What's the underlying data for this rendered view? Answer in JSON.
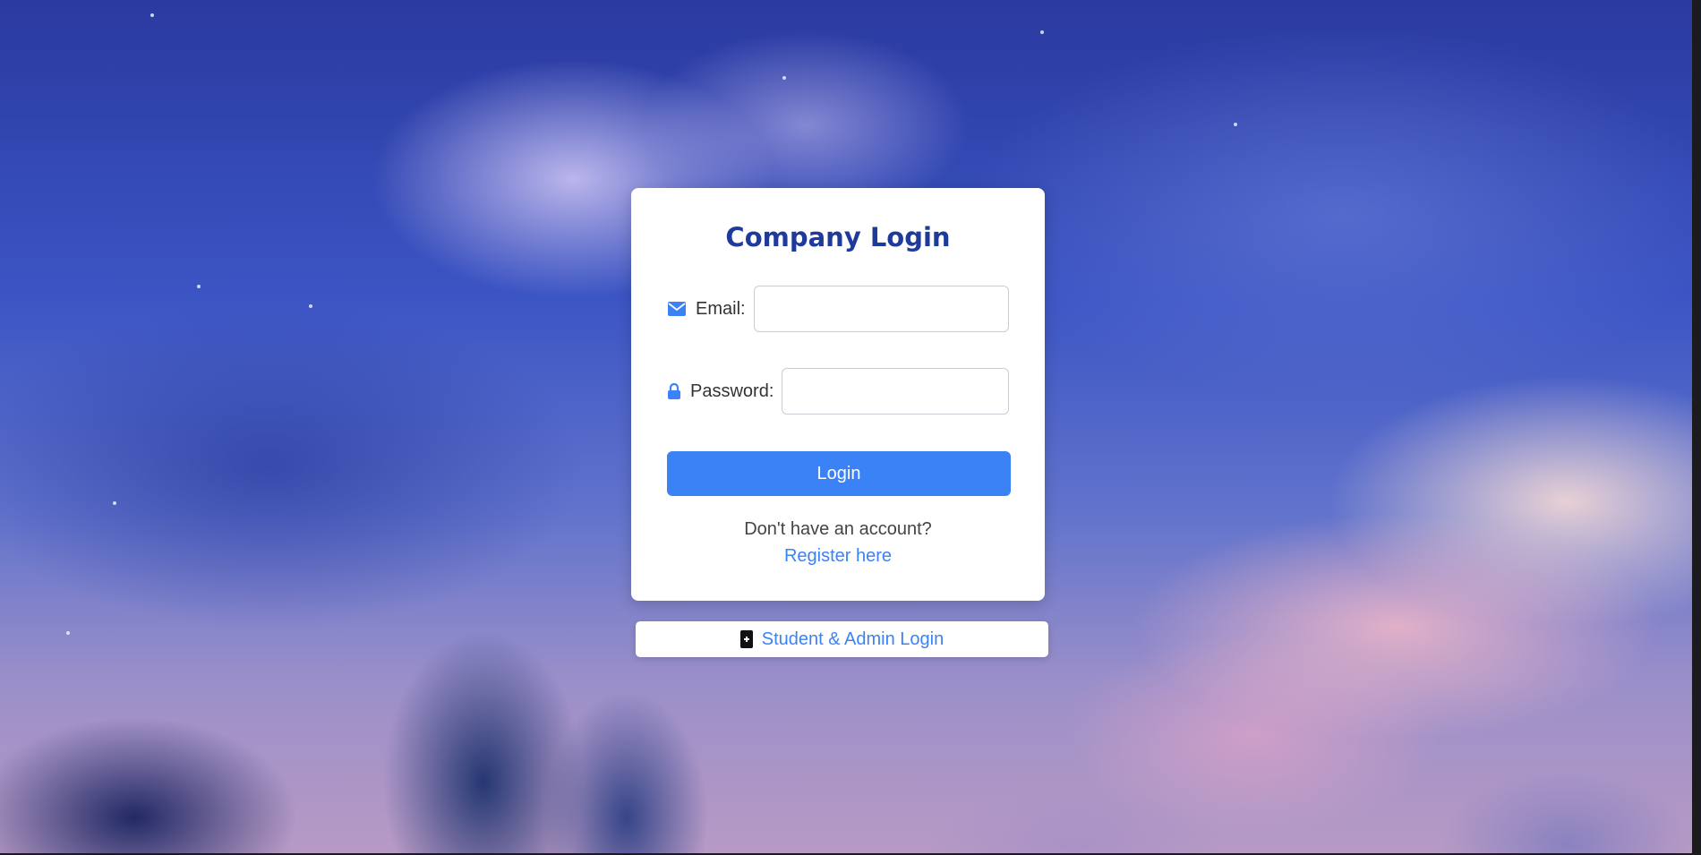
{
  "login_card": {
    "title": "Company Login",
    "email": {
      "label": "Email:",
      "value": "",
      "icon": "envelope-icon"
    },
    "password": {
      "label": "Password:",
      "value": "",
      "icon": "lock-icon"
    },
    "login_button_label": "Login",
    "no_account_text": "Don't have an account?",
    "register_link_text": "Register here"
  },
  "alt_login": {
    "label": "Student & Admin Login",
    "icon": "id-badge-icon"
  },
  "colors": {
    "accent": "#3b82f6",
    "title": "#1e3a9a",
    "card_background": "#ffffff"
  }
}
